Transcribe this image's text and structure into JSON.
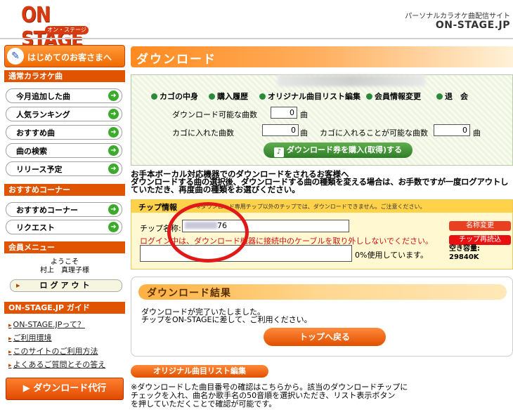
{
  "header": {
    "logo_text": "ON STAGE",
    "logo_sub": "オン・ステージ",
    "tagline": "パーソナルカラオケ曲配信サイト",
    "brand_url": "ON-STAGE.JP"
  },
  "sidebar": {
    "first_visit": "はじめてのお客さまへ",
    "karaoke_header": "通常カラオケ曲",
    "karaoke_items": [
      "今月追加した曲",
      "人気ランキング",
      "おすすめ曲",
      "曲の検索",
      "リリース予定"
    ],
    "recommend_header": "おすすめコーナー",
    "recommend_items": [
      "おすすめコーナー",
      "リクエスト"
    ],
    "member_header": "会員メニュー",
    "welcome": "ようこそ",
    "user_name": "村上　真理子様",
    "logout": "ログアウト",
    "guide_header": "ON-STAGE.JP ガイド",
    "guide_links": [
      "ON-STAGE.JPって？",
      "ご利用環境",
      "このサイトのご利用方法",
      "よくあるご質問とその答え"
    ],
    "download_exec": "ダウンロード代行"
  },
  "main": {
    "title": "ダウンロード",
    "nav_links": [
      "カゴの中身",
      "購入履歴",
      "オリジナル曲目リスト編集",
      "会員情報変更",
      "退　会"
    ],
    "downloadable_label": "ダウンロード可能な曲数",
    "downloadable_value": "0",
    "in_cart_label": "カゴに入れた曲数",
    "in_cart_value": "0",
    "cart_possible_label": "カゴに入れることが可能な曲数",
    "cart_possible_value": "0",
    "unit": "曲",
    "buy_button": "ダウンロード券を購入(取得)する",
    "notice_lines": [
      "お手本ボーカル対応機器でのダウンロードをされるお客様へ",
      "ダウンロードする曲の選択後、ダウンロードする曲の種類を変える場合は、お手数ですが一度ログアウトし",
      "ていただき、再度曲の種類をお選びください。"
    ]
  },
  "chip": {
    "header": "チップ情報",
    "header_note": "※ダウンロード専用チップ以外のチップでは、ダウンロードできません。ご注意ください。",
    "name_label": "チップ名称:",
    "name_suffix": "76",
    "warning": "ログイン中は、ダウンロード機器に接続中のケーブルを取り外ししないでください。",
    "usage_text": "0%使用しています。",
    "rename_button": "名称変更",
    "reload_button": "チップ再読込",
    "free_label": "空き容量:",
    "free_value": "29840K"
  },
  "result": {
    "title": "ダウンロード結果",
    "messages": [
      "ダウンロードが完了いたしました。",
      "チップをON-STAGEに差して、ご利用ください。"
    ],
    "top_button": "トップへ戻る"
  },
  "original": {
    "tab": "オリジナル曲目リスト編集",
    "lines": [
      "※ダウンロードした曲目番号の確認はこちらから。該当のダウンロードチップに",
      "チェックを入れ、曲名か歌手名の50音順を選択いただき、リスト表示ボタン",
      "を押していただくことで確認が可能です。"
    ]
  }
}
